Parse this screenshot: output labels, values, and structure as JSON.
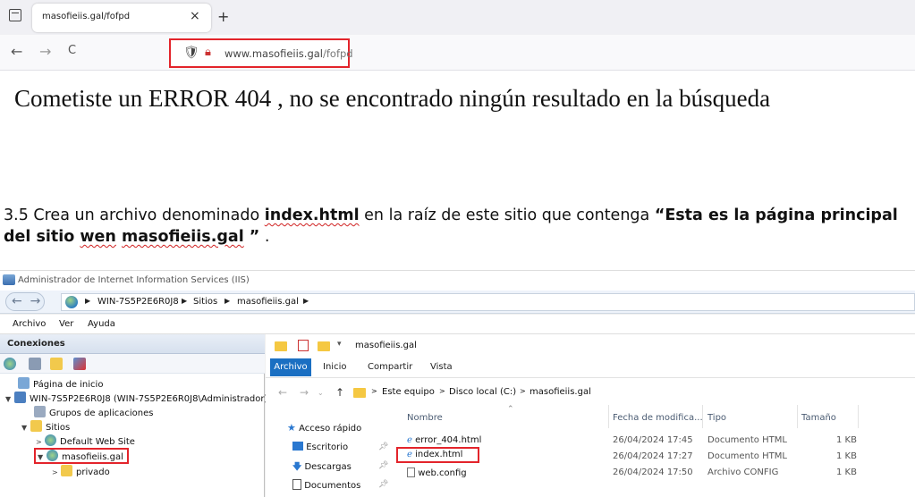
{
  "browser": {
    "tab_title": "masofieiis.gal/fofpd",
    "tab_close": "×",
    "new_tab": "+",
    "back": "←",
    "forward": "→",
    "reload": "C",
    "url_domain": "www.masofieiis.gal",
    "url_path": "/fofpd"
  },
  "page": {
    "error_message": "Cometiste un ERROR 404 , no se encontrado ningún resultado en la búsqueda"
  },
  "instruction": {
    "part1": "3.5 Crea un archivo denominado ",
    "file_name": "index.html",
    "part2": " en la raíz de este sitio que contenga ",
    "quote_open": "“Esta es la página principal del sitio ",
    "word_wen": "wen",
    "space": " ",
    "site_name": "masofieiis.gal",
    "quote_close": " ”",
    "end": " ."
  },
  "iis": {
    "window_title": "Administrador de Internet Information Services (IIS)",
    "breadcrumb": [
      "WIN-7S5P2E6R0J8",
      "Sitios",
      "masofieiis.gal"
    ],
    "menu": [
      "Archivo",
      "Ver",
      "Ayuda"
    ],
    "connections_title": "Conexiones",
    "tree": [
      {
        "label": "Página de inicio"
      },
      {
        "label": "WIN-7S5P2E6R0J8 (WIN-7S5P2E6R0J8\\Administrador)"
      },
      {
        "label": "Grupos de aplicaciones"
      },
      {
        "label": "Sitios"
      },
      {
        "label": "Default Web Site"
      },
      {
        "label": "masofieiis.gal"
      },
      {
        "label": "privado"
      }
    ]
  },
  "explorer": {
    "title": "masofieiis.gal",
    "ribbon_file": "Archivo",
    "ribbon_tabs": [
      "Inicio",
      "Compartir",
      "Vista"
    ],
    "path": [
      "Este equipo",
      "Disco local (C:)",
      "masofieiis.gal"
    ],
    "quick_access": [
      {
        "label": "Acceso rápido"
      },
      {
        "label": "Escritorio"
      },
      {
        "label": "Descargas"
      },
      {
        "label": "Documentos"
      }
    ],
    "columns": [
      "Nombre",
      "Fecha de modifica...",
      "Tipo",
      "Tamaño"
    ],
    "files": [
      {
        "name": "error_404.html",
        "date": "26/04/2024 17:45",
        "type": "Documento HTML",
        "size": "1 KB"
      },
      {
        "name": "index.html",
        "date": "26/04/2024 17:27",
        "type": "Documento HTML",
        "size": "1 KB"
      },
      {
        "name": "web.config",
        "date": "26/04/2024 17:50",
        "type": "Archivo CONFIG",
        "size": "1 KB"
      }
    ]
  },
  "colors": {
    "highlight": "#e3242b",
    "ribbon_file": "#1a6fc2",
    "folder": "#f5c842"
  }
}
